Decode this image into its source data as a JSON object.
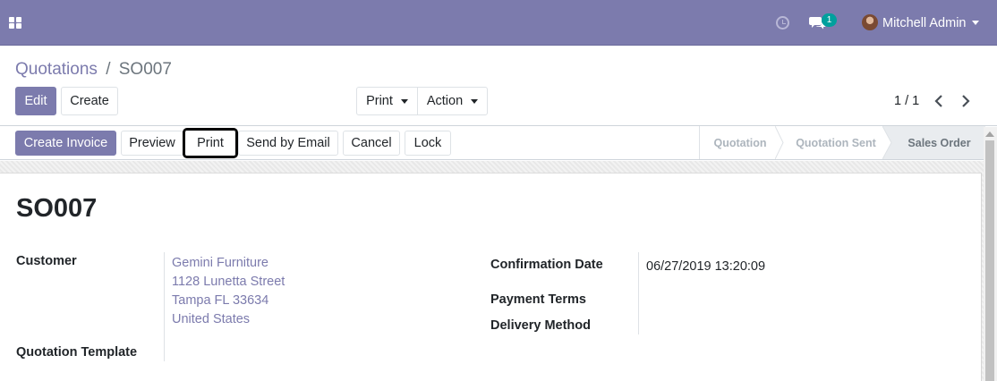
{
  "navbar": {
    "user_name": "Mitchell Admin",
    "chat_badge_count": "1",
    "brand_color": "#7c7bad",
    "icons": [
      "apps-icon",
      "activity-clock-icon",
      "messaging-icon",
      "user-avatar",
      "caret-down-icon"
    ]
  },
  "breadcrumb": {
    "parent": "Quotations",
    "separator": "/",
    "current": "SO007"
  },
  "control_panel": {
    "edit_label": "Edit",
    "create_label": "Create",
    "print_label": "Print",
    "action_label": "Action",
    "pager_value": "1 / 1"
  },
  "statusbar": {
    "buttons": {
      "create_invoice": "Create Invoice",
      "preview": "Preview",
      "print": "Print",
      "send_by_email": "Send by Email",
      "cancel": "Cancel",
      "lock": "Lock"
    },
    "stages": [
      "Quotation",
      "Quotation Sent",
      "Sales Order"
    ],
    "active_stage": "Sales Order"
  },
  "form": {
    "title": "SO007",
    "customer_label": "Customer",
    "customer_name": "Gemini Furniture",
    "customer_address_line1": "1128 Lunetta Street",
    "customer_address_line2": "Tampa FL 33634",
    "customer_address_line3": "United States",
    "quotation_template_label": "Quotation Template",
    "confirmation_date_label": "Confirmation Date",
    "confirmation_date_value": "06/27/2019 13:20:09",
    "payment_terms_label": "Payment Terms",
    "delivery_method_label": "Delivery Method"
  }
}
